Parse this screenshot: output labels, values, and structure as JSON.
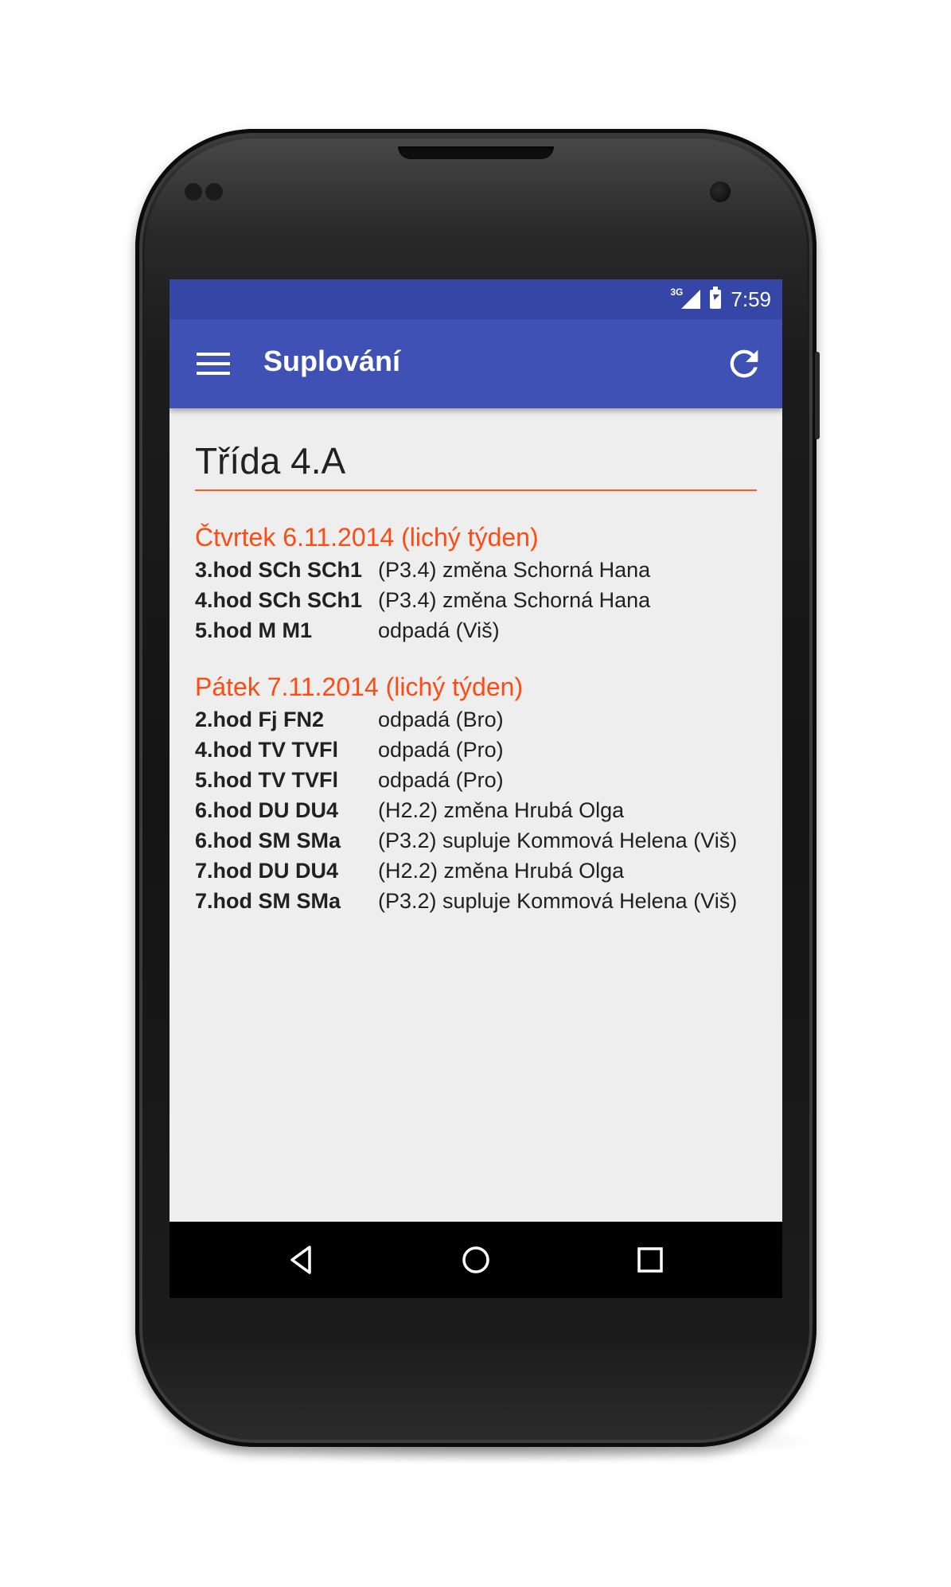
{
  "status_bar": {
    "network": "3G",
    "time": "7:59"
  },
  "app_bar": {
    "title": "Suplování",
    "menu_icon": "menu-icon",
    "refresh_icon": "refresh-icon",
    "background_color": "#3f51b5",
    "status_color": "#3546a6"
  },
  "content": {
    "class_title": "Třída 4.A",
    "accent_color": "#ff5722",
    "days": [
      {
        "header": "Čtvrtek 6.11.2014  (lichý týden)",
        "rows": [
          {
            "lesson": "3.hod SCh SCh1",
            "change": "(P3.4) změna Schorná Hana"
          },
          {
            "lesson": "4.hod SCh SCh1",
            "change": "(P3.4) změna Schorná Hana"
          },
          {
            "lesson": "5.hod M M1",
            "change": "odpadá  (Viš)"
          }
        ]
      },
      {
        "header": "Pátek 7.11.2014  (lichý týden)",
        "rows": [
          {
            "lesson": "2.hod Fj FN2",
            "change": "odpadá  (Bro)"
          },
          {
            "lesson": "4.hod TV TVFl",
            "change": "odpadá  (Pro)"
          },
          {
            "lesson": "5.hod TV TVFl",
            "change": "odpadá  (Pro)"
          },
          {
            "lesson": "6.hod DU DU4",
            "change": "(H2.2) změna Hrubá Olga"
          },
          {
            "lesson": "6.hod SM SMa",
            "change": "(P3.2) supluje Kommová Helena (Viš)"
          },
          {
            "lesson": "7.hod DU DU4",
            "change": "(H2.2) změna Hrubá Olga"
          },
          {
            "lesson": "7.hod SM SMa",
            "change": "(P3.2) supluje Kommová Helena (Viš)"
          }
        ]
      }
    ]
  },
  "nav_bar": {
    "back_icon": "back-icon",
    "home_icon": "home-icon",
    "recents_icon": "recents-icon"
  }
}
